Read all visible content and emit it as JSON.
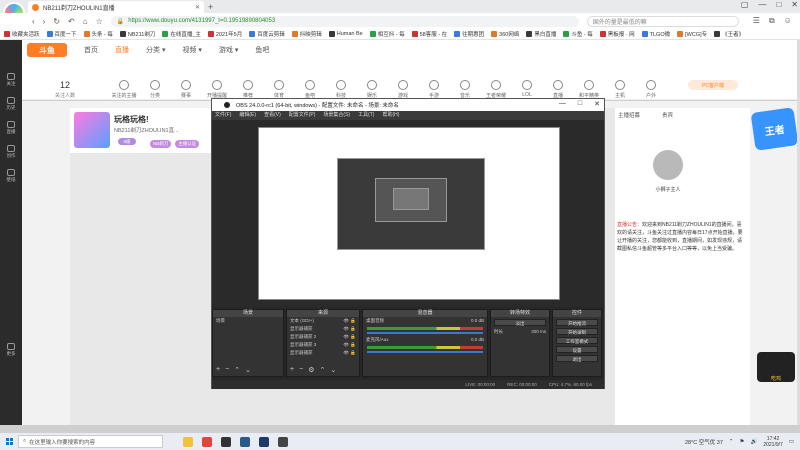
{
  "browser": {
    "logo_label": "浏览器",
    "tab_title": "NB211剃刀ZHOULIN1直播",
    "url": "https://www.douyu.com/4131997_t=0.19519890804053",
    "search_placeholder": "国外的量是最低的嘛",
    "bookmarks": [
      "收藏夹活跃",
      "百度一下",
      "头条 - 每",
      "NB211剃刀",
      "在线直播_主",
      "2021年5月",
      "百度云剪辑",
      "抖映剪辑",
      "Human Be",
      "相互抖 - 每",
      "58客服 - 在",
      "往期惠团",
      "360网络",
      "黑白直播",
      "斗鱼 - 每",
      "黑板报 · 网",
      "TLGO微",
      "[WCG]专",
      "《王者》"
    ]
  },
  "leftnav": {
    "items": [
      "关注",
      "历史",
      "直播",
      "创作",
      "壁纸",
      "更多"
    ]
  },
  "site": {
    "logo": "斗鱼",
    "nav": [
      "首页",
      "直播",
      "分类 ▾",
      "视频 ▾",
      "游戏 ▾",
      "鱼吧"
    ],
    "categories": [
      "关注的主播",
      "分类",
      "赛事",
      "开播提醒",
      "推荐",
      "体育",
      "鱼吧",
      "科技",
      "娱乐",
      "游戏",
      "手游",
      "音乐",
      "王者荣耀",
      "LOL",
      "直播",
      "和平精英",
      "主机",
      "户外",
      "PC客户端"
    ],
    "follow_count": "12",
    "follow_label": "关注人数",
    "pc_client_btn": "PC客户端",
    "room_title": "玩格玩格!",
    "room_name": "NB211剃刀ZHOULIN1直...",
    "level_badge": "5级",
    "tags": [
      "NB剃刀",
      "主播认证"
    ],
    "right_tabs": [
      "主播招募",
      "贵宾"
    ],
    "anchor_text": "小狮子主人",
    "notice_label": "直播公告：",
    "notice_text": "欢迎来到NB211剃刀ZHOULIN1的直播间，喜欢的请关注，斗鱼关注过直播内容每日17点开始直播，要让开播的关注，您都能收到，直播期间，如发现违规，请截图私信斗鱼超管等多平台入口等等，以免上当受骗。",
    "badge_art": "王者",
    "pubg_art": "吃鸡"
  },
  "obs": {
    "title": "OBS 24.0.0-rc1 (64-bit, windows) - 配置文件: 未命名 - 场景: 未命名",
    "menu": [
      "文件(F)",
      "编辑(E)",
      "查看(V)",
      "配置文件(P)",
      "场景集合(S)",
      "工具(T)",
      "帮助(H)"
    ],
    "docks": {
      "scenes": {
        "title": "场景",
        "items": [
          "场景"
        ]
      },
      "sources": {
        "title": "来源",
        "items": [
          "文本 (GDI+)",
          "显示器捕获",
          "显示器捕获 2",
          "显示器捕获 3",
          "显示器捕获"
        ]
      },
      "mixer": {
        "title": "混音器",
        "tracks": [
          "桌面音频",
          "麦克风/Aux"
        ],
        "levels": [
          "0.0 dB",
          "0.0 dB"
        ]
      },
      "transitions": {
        "title": "转场特效",
        "type": "淡出",
        "duration_label": "时长",
        "duration": "300 ms"
      },
      "controls": {
        "title": "控件",
        "buttons": [
          "开始推流",
          "开始录制",
          "工作室模式",
          "设置",
          "退出"
        ]
      }
    },
    "status": {
      "live": "LIVE: 00:00:00",
      "rec": "REC: 00:00:00",
      "cpu": "CPU: 4.7%, 60.00 fps"
    }
  },
  "taskbar": {
    "search_placeholder": "在这里输入你要搜索的内容",
    "weather": "28°C 空气优 37",
    "time": "17:42",
    "date": "2021/9/7"
  }
}
